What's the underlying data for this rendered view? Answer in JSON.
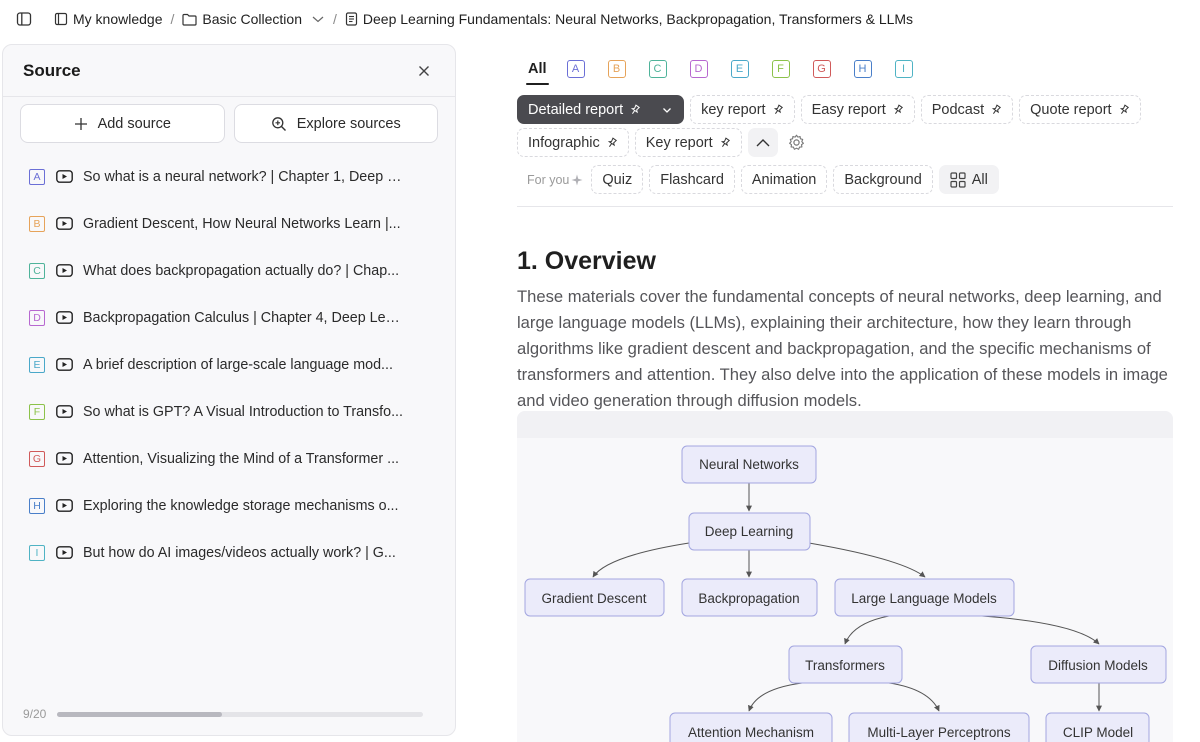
{
  "breadcrumb": {
    "root": "My knowledge",
    "collection": "Basic Collection",
    "document": "Deep Learning Fundamentals: Neural Networks, Backpropagation, Transformers & LLMs",
    "separator": "/"
  },
  "source_panel": {
    "title": "Source",
    "add_label": "Add source",
    "explore_label": "Explore sources",
    "count_label": "9/20",
    "scroll_fraction": 0.45,
    "items": [
      {
        "letter": "A",
        "color": "#6b6fd6",
        "title": "So what is a neural network? | Chapter 1, Deep L..."
      },
      {
        "letter": "B",
        "color": "#e6a35a",
        "title": "Gradient Descent, How Neural Networks Learn |..."
      },
      {
        "letter": "C",
        "color": "#4fb39a",
        "title": "What does backpropagation actually do? | Chap..."
      },
      {
        "letter": "D",
        "color": "#b768d0",
        "title": "Backpropagation Calculus | Chapter 4, Deep Lea..."
      },
      {
        "letter": "E",
        "color": "#4aa8c9",
        "title": "A brief description of large-scale language mod..."
      },
      {
        "letter": "F",
        "color": "#8cc24a",
        "title": "So what is GPT? A Visual Introduction to Transfo..."
      },
      {
        "letter": "G",
        "color": "#d05a5a",
        "title": "Attention, Visualizing the Mind of a Transformer ..."
      },
      {
        "letter": "H",
        "color": "#4a7fc9",
        "title": "Exploring the knowledge storage mechanisms o..."
      },
      {
        "letter": "I",
        "color": "#4fb3c4",
        "title": "But how do AI images/videos actually work? | G..."
      }
    ]
  },
  "filters": {
    "all_label": "All",
    "letters": [
      {
        "letter": "A",
        "color": "#6b6fd6"
      },
      {
        "letter": "B",
        "color": "#e6a35a"
      },
      {
        "letter": "C",
        "color": "#4fb39a"
      },
      {
        "letter": "D",
        "color": "#b768d0"
      },
      {
        "letter": "E",
        "color": "#4aa8c9"
      },
      {
        "letter": "F",
        "color": "#8cc24a"
      },
      {
        "letter": "G",
        "color": "#d05a5a"
      },
      {
        "letter": "H",
        "color": "#4a7fc9"
      },
      {
        "letter": "I",
        "color": "#4fb3c4"
      }
    ]
  },
  "reports": {
    "row1": [
      "Detailed report",
      "key report",
      "Easy report",
      "Podcast",
      "Quote report"
    ],
    "row2": [
      "Infographic",
      "Key report"
    ]
  },
  "tools": {
    "for_you_label": "For you",
    "items": [
      "Quiz",
      "Flashcard",
      "Animation",
      "Background"
    ],
    "all_label": "All"
  },
  "content": {
    "heading": "1. Overview",
    "paragraph": "These materials cover the fundamental concepts of neural networks, deep learning, and large language models (LLMs), explaining their architecture, how they learn through algorithms like gradient descent and backpropagation, and the specific mechanisms of transformers and attention. They also delve into the application of these models in image and video generation through diffusion models."
  },
  "diagram": {
    "nodes": {
      "nn": "Neural Networks",
      "dl": "Deep Learning",
      "gd": "Gradient Descent",
      "bp": "Backpropagation",
      "llm": "Large Language Models",
      "tf": "Transformers",
      "dm": "Diffusion Models",
      "am": "Attention Mechanism",
      "mlp": "Multi-Layer Perceptrons",
      "clip": "CLIP Model"
    }
  }
}
